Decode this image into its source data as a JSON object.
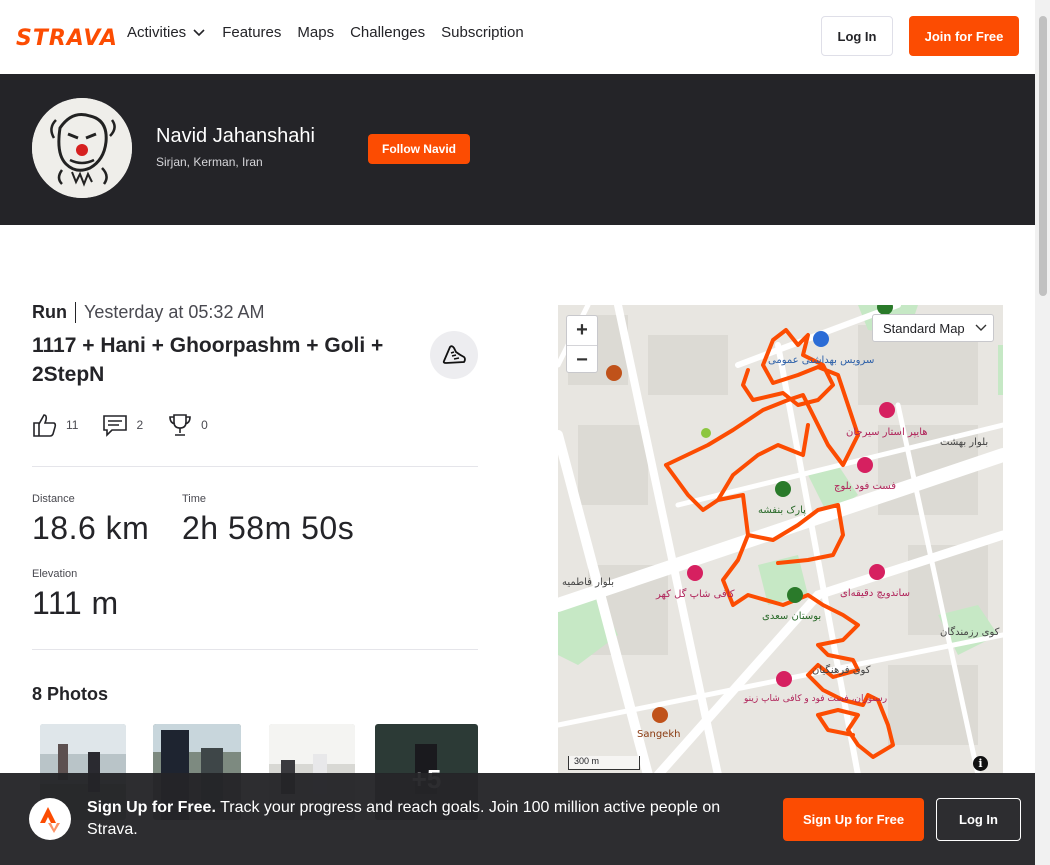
{
  "nav": {
    "logo": "STRAVA",
    "links": [
      "Activities",
      "Features",
      "Maps",
      "Challenges",
      "Subscription"
    ],
    "login": "Log In",
    "join": "Join for Free"
  },
  "athlete": {
    "name": "Navid Jahanshahi",
    "location": "Sirjan, Kerman, Iran",
    "follow": "Follow Navid"
  },
  "activity": {
    "type": "Run",
    "time": "Yesterday at 05:32 AM",
    "title": "1117 + Hani + Ghoorpashm + Goli + 2StepN",
    "kudos": "11",
    "comments": "2",
    "achievements": "0",
    "stats": {
      "distance_label": "Distance",
      "distance": "18.6 km",
      "time_label": "Time",
      "time": "2h 58m 50s",
      "elevation_label": "Elevation",
      "elevation": "111 m"
    },
    "photos_title": "8 Photos",
    "photos_more": "+5"
  },
  "map": {
    "style": "Standard Map",
    "scale": "300 m",
    "labels": [
      "سرویس بهداشتی عمومی",
      "هایپر استار سیرجان",
      "فست فود بلوچ",
      "پارک بنفشه",
      "کافی شاپ گل کهر",
      "ساندویچ دقیقه‌ای",
      "بوستان سعدی",
      "رستوران، فست فود و کافی شاپ زینو",
      "Sangekh",
      "کوی فرهنگیان",
      "بلوار بهشت",
      "بلوار فاطمیه",
      "کوی رزمندگان"
    ],
    "route_color": "#fc4c02"
  },
  "signup": {
    "lead": "Sign Up for Free.",
    "text": "Track your progress and reach goals. Join 100 million active people on Strava.",
    "button": "Sign Up for Free",
    "login": "Log In"
  }
}
